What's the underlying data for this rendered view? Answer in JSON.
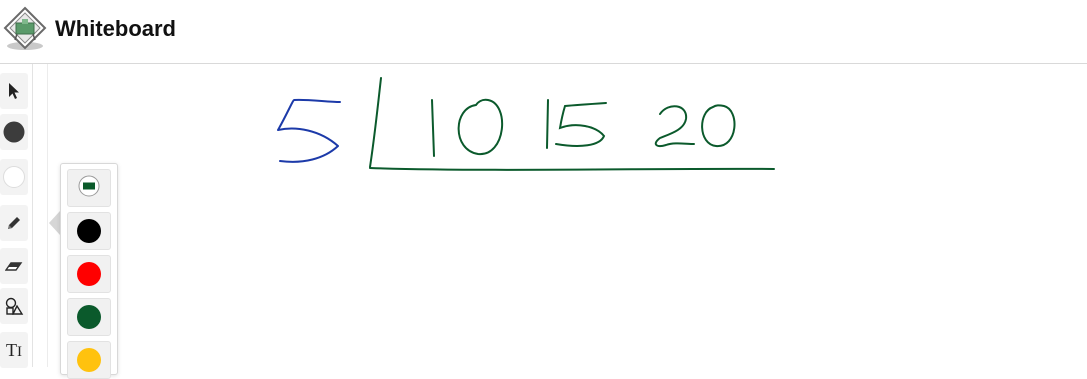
{
  "app": {
    "title": "Whiteboard",
    "logo_icon": "whiteboard-logo-icon"
  },
  "toolbar": {
    "tools": [
      {
        "name": "select",
        "icon": "cursor-icon"
      },
      {
        "name": "stroke-color",
        "icon": "filled-circle-icon",
        "color": "#3c3c3c"
      },
      {
        "name": "fill-color",
        "icon": "empty-circle-icon",
        "color": "#ffffff"
      },
      {
        "name": "pencil",
        "icon": "pencil-icon"
      },
      {
        "name": "eraser",
        "icon": "eraser-icon"
      },
      {
        "name": "shapes",
        "icon": "shapes-icon"
      },
      {
        "name": "text",
        "icon": "text-icon",
        "label": "T"
      }
    ]
  },
  "palette": {
    "colors": [
      {
        "name": "green-rect",
        "icon": "rectangle-swatch-icon",
        "color": "#0a5a2a"
      },
      {
        "name": "black",
        "color": "#000000"
      },
      {
        "name": "red",
        "color": "#ff0000"
      },
      {
        "name": "dark-green",
        "color": "#0b5a2c"
      },
      {
        "name": "yellow",
        "color": "#ffc20e"
      }
    ]
  },
  "canvas": {
    "strokes": [
      {
        "text": "5",
        "color": "#1c3aa9"
      },
      {
        "text": "10",
        "color": "#0b5a2c"
      },
      {
        "text": "15",
        "color": "#0b5a2c"
      },
      {
        "text": "20",
        "color": "#0b5a2c"
      }
    ]
  }
}
